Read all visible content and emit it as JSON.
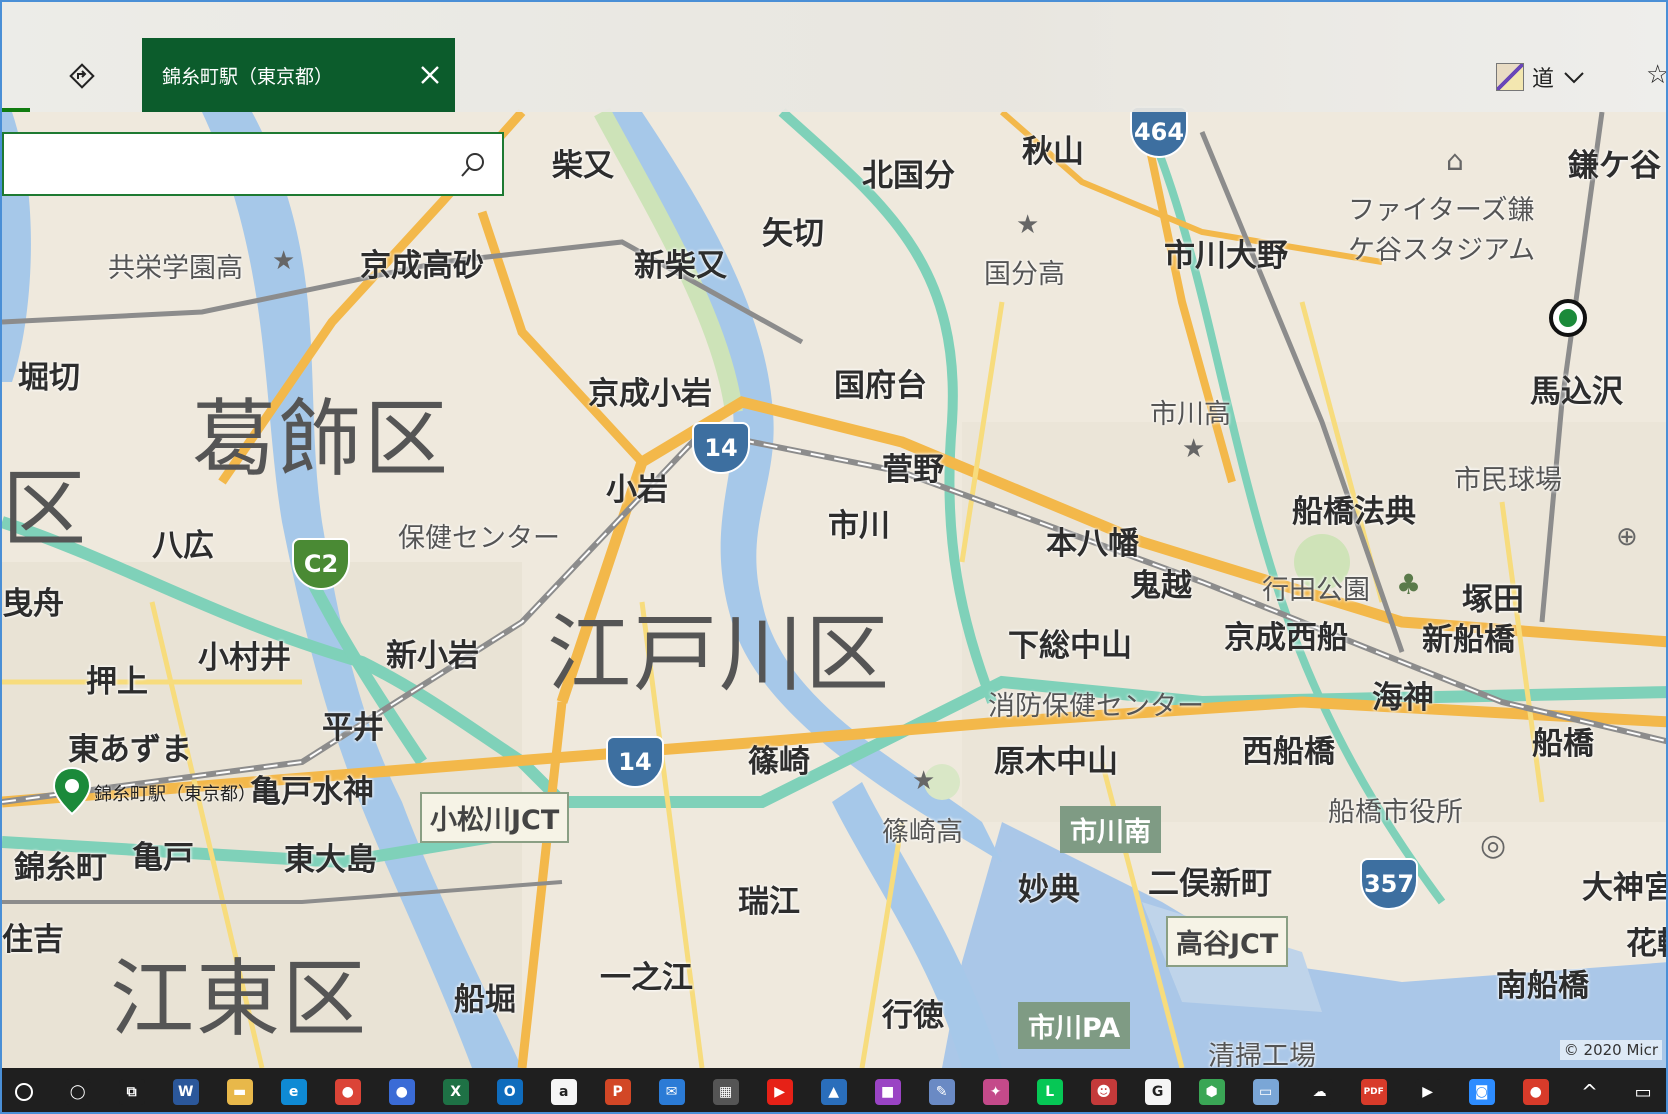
{
  "app": {
    "tab_title": "錦糸町駅（東京都）",
    "style_label": "道",
    "copyright": "© 2020 Micr"
  },
  "search": {
    "value": "",
    "placeholder": ""
  },
  "wards": [
    "葛飾区",
    "江戸川区",
    "江東区",
    "区"
  ],
  "stations": [
    "柴又",
    "北国分",
    "秋山",
    "市川大野",
    "矢切",
    "京成高砂",
    "新柴又",
    "堀切",
    "京成小岩",
    "国府台",
    "馬込沢",
    "小岩",
    "菅野",
    "市川",
    "船橋法典",
    "八広",
    "本八幡",
    "鬼越",
    "塚田",
    "新船橋",
    "京成西船",
    "曳舟",
    "押上",
    "小村井",
    "新小岩",
    "下総中山",
    "平井",
    "海神",
    "東あずま",
    "西船橋",
    "船橋",
    "亀戸水神",
    "篠崎",
    "原木中山",
    "錦糸町",
    "亀戸",
    "東大島",
    "市川南",
    "二俣新町",
    "住吉",
    "瑞江",
    "妙典",
    "大神宮",
    "船堀",
    "一之江",
    "行徳",
    "南船橋",
    "市川PA",
    "鎌ケ谷",
    "花輪"
  ],
  "pois": [
    "共栄学園高",
    "国分高",
    "市川高",
    "ファイターズ鎌",
    "ケ谷スタジアム",
    "保健センター",
    "市民球場",
    "行田公園",
    "消防保健センター",
    "篠崎高",
    "船橋市役所",
    "清掃工場"
  ],
  "shields": [
    "464",
    "14",
    "14",
    "C2",
    "357"
  ],
  "junctions": [
    "小松川JCT",
    "高谷JCT"
  ],
  "pin": {
    "label": "錦糸町駅（東京都）"
  },
  "taskbar": {
    "apps": [
      {
        "name": "cortana",
        "glyph": "◯",
        "color": "#1f1f1f"
      },
      {
        "name": "task-view",
        "glyph": "⧉",
        "color": "#1f1f1f"
      },
      {
        "name": "word",
        "glyph": "W",
        "color": "#2b579a"
      },
      {
        "name": "file-explorer",
        "glyph": "▬",
        "color": "#e8b84a"
      },
      {
        "name": "edge",
        "glyph": "e",
        "color": "#0f8ad4"
      },
      {
        "name": "chrome",
        "glyph": "●",
        "color": "#db4437"
      },
      {
        "name": "people",
        "glyph": "●",
        "color": "#3a6bd6"
      },
      {
        "name": "excel",
        "glyph": "X",
        "color": "#1e7145"
      },
      {
        "name": "outlook",
        "glyph": "O",
        "color": "#0f6cbd"
      },
      {
        "name": "amazon",
        "glyph": "a",
        "color": "#f5f5f5"
      },
      {
        "name": "powerpoint",
        "glyph": "P",
        "color": "#d24726"
      },
      {
        "name": "mail",
        "glyph": "✉",
        "color": "#2b7bd6"
      },
      {
        "name": "network",
        "glyph": "▦",
        "color": "#555"
      },
      {
        "name": "youtube",
        "glyph": "▶",
        "color": "#e62117"
      },
      {
        "name": "photos",
        "glyph": "▲",
        "color": "#2a6ebb"
      },
      {
        "name": "colors",
        "glyph": "■",
        "color": "#9a44c4"
      },
      {
        "name": "paint",
        "glyph": "✎",
        "color": "#6a8ac4"
      },
      {
        "name": "paint-3d",
        "glyph": "✦",
        "color": "#c44a8a"
      },
      {
        "name": "line",
        "glyph": "L",
        "color": "#06c755"
      },
      {
        "name": "game",
        "glyph": "☻",
        "color": "#c43a3a"
      },
      {
        "name": "google",
        "glyph": "G",
        "color": "#f5f5f5"
      },
      {
        "name": "maps",
        "glyph": "⬢",
        "color": "#3aa655"
      },
      {
        "name": "inbox",
        "glyph": "▭",
        "color": "#7aa6d6"
      },
      {
        "name": "onedrive",
        "glyph": "☁",
        "color": "#1f1f1f"
      },
      {
        "name": "pdf",
        "glyph": "PDF",
        "color": "#d83b2a"
      },
      {
        "name": "play-store",
        "glyph": "▶",
        "color": "#1f1f1f"
      },
      {
        "name": "zoom",
        "glyph": "◙",
        "color": "#2d8cff"
      },
      {
        "name": "maps-app",
        "glyph": "●",
        "color": "#d83b2a"
      }
    ]
  }
}
